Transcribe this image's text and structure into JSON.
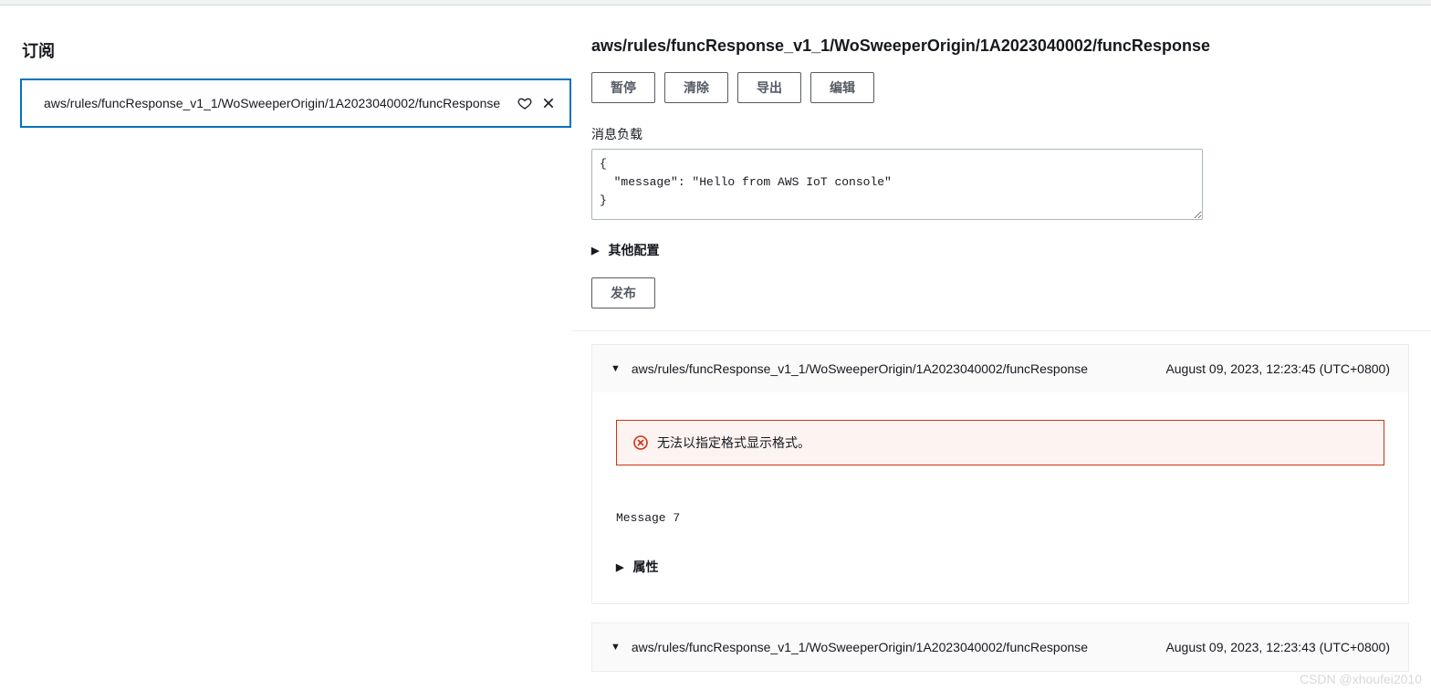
{
  "sidebar": {
    "title": "订阅",
    "subscriptions": [
      {
        "topic": "aws/rules/funcResponse_v1_1/WoSweeperOrigin/1A2023040002/funcResponse"
      }
    ]
  },
  "main": {
    "topic_title": "aws/rules/funcResponse_v1_1/WoSweeperOrigin/1A2023040002/funcResponse",
    "actions": {
      "pause": "暂停",
      "clear": "清除",
      "export": "导出",
      "edit": "编辑"
    },
    "payload_label": "消息负载",
    "payload_value": "{\n  \"message\": \"Hello from AWS IoT console\"\n}",
    "extra_config_label": "其他配置",
    "publish_label": "发布"
  },
  "messages": [
    {
      "topic": "aws/rules/funcResponse_v1_1/WoSweeperOrigin/1A2023040002/funcResponse",
      "timestamp": "August 09, 2023, 12:23:45 (UTC+0800)",
      "error_text": "无法以指定格式显示格式。",
      "content": "Message 7",
      "attrs_label": "属性"
    },
    {
      "topic": "aws/rules/funcResponse_v1_1/WoSweeperOrigin/1A2023040002/funcResponse",
      "timestamp": "August 09, 2023, 12:23:43 (UTC+0800)"
    }
  ],
  "watermark": "CSDN @xhoufei2010"
}
